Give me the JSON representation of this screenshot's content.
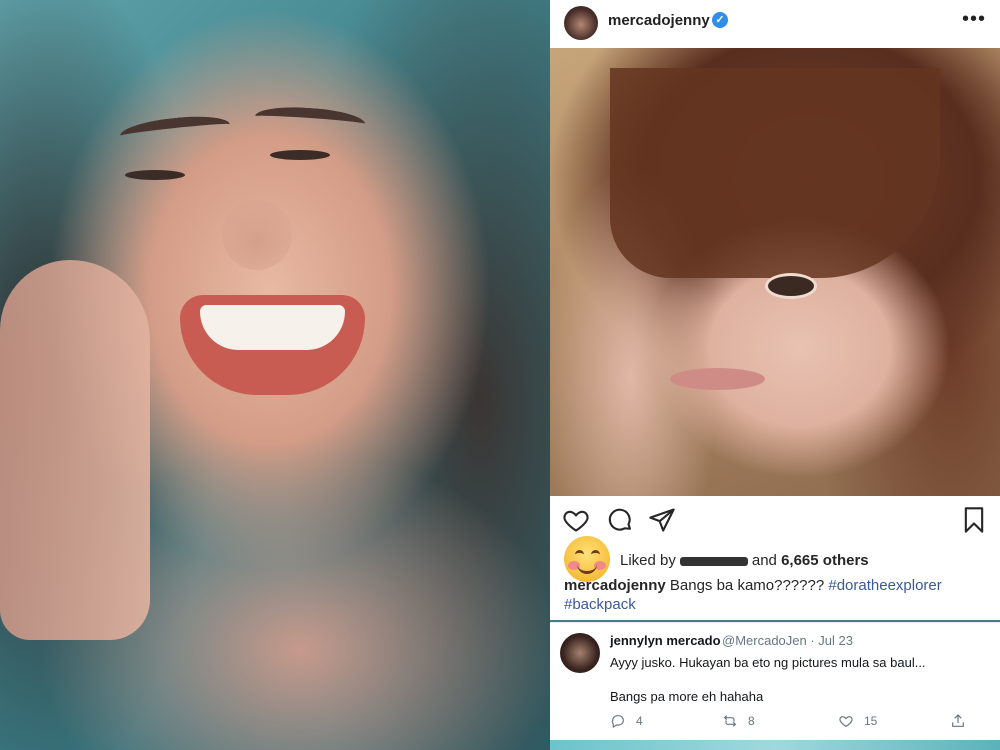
{
  "instagram": {
    "username": "mercadojenny",
    "verified_mark": "✓",
    "more_icon": "•••",
    "icons": [
      "heart-icon",
      "comment-icon",
      "share-icon",
      "bookmark-icon"
    ],
    "liked_prefix": "Liked by",
    "liked_and": "and",
    "liked_others": "6,665 others",
    "caption_user": "mercadojenny",
    "caption_text": "Bangs ba kamo??????",
    "hashtag_1": "#doratheexplorer",
    "hashtag_2": "#backpack"
  },
  "tweet": {
    "name": "jennylyn mercado",
    "handle": "@MercadoJen · Jul 23",
    "line1": "Ayyy jusko. Hukayan ba eto ng pictures mula sa baul...",
    "line2": "Bangs pa more eh hahaha",
    "replies": "4",
    "retweets": "8",
    "likes": "15"
  },
  "colors": {
    "verified_blue": "#2f8eea",
    "hashtag_blue": "#3b5998",
    "teal_background": "#3f7f86",
    "twitter_gray": "#657786"
  }
}
